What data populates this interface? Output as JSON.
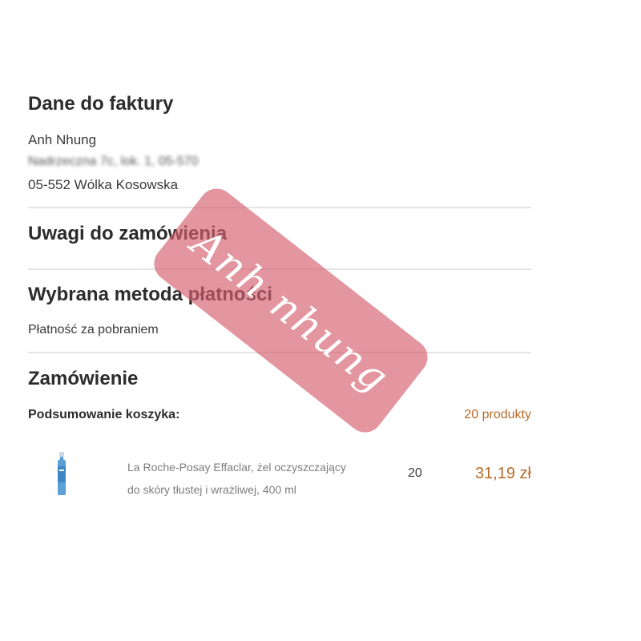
{
  "billing": {
    "title": "Dane do faktury",
    "name": "Anh Nhung",
    "street": "Nadrzeczna 7c, lok. 1, 05-570",
    "city": "05-552 Wólka Kosowska"
  },
  "notes": {
    "title": "Uwagi do zamówienia"
  },
  "payment": {
    "title": "Wybrana metoda płatności",
    "method": "Płatność za pobraniem"
  },
  "order": {
    "title": "Zamówienie",
    "summary_label": "Podsumowanie koszyka:",
    "product_count": "20 produkty",
    "items": [
      {
        "name_line1": "La Roche-Posay Effaclar, żel oczyszczający",
        "name_line2": "do skóry tłustej i wrażliwej, 400 ml",
        "quantity": "20",
        "price": "31,19 zł",
        "icon": "product-bottle-icon"
      }
    ]
  },
  "watermark": {
    "text": "Anh nhung"
  },
  "colors": {
    "accent": "#b86b2a",
    "heading": "#2c2c2c",
    "text": "#3a3a3a",
    "divider": "#e4e4e4",
    "watermark": "#d45f6e"
  }
}
